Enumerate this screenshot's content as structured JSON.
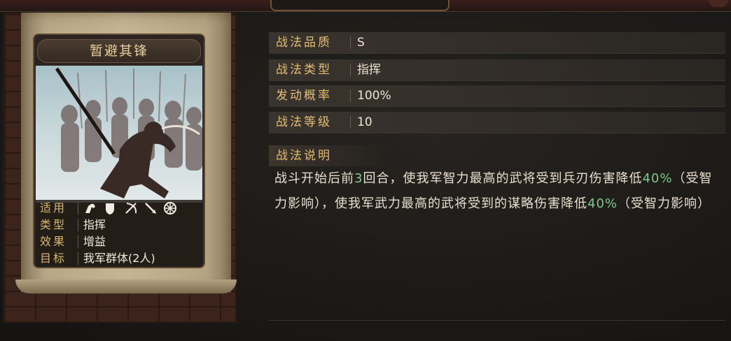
{
  "skill_card": {
    "title": "暂避其锋",
    "info_rows": [
      {
        "key": "适用",
        "value": ""
      },
      {
        "key": "类型",
        "value": "指挥"
      },
      {
        "key": "效果",
        "value": "增益"
      },
      {
        "key": "目标",
        "value": "我军群体(2人)"
      }
    ],
    "applicable_icons": [
      "cavalry-icon",
      "shield-icon",
      "bow-icon",
      "spear-icon",
      "wheel-icon"
    ]
  },
  "stats": [
    {
      "key": "战法品质",
      "value": "S"
    },
    {
      "key": "战法类型",
      "value": "指挥"
    },
    {
      "key": "发动概率",
      "value": "100%"
    },
    {
      "key": "战法等级",
      "value": "10"
    }
  ],
  "description": {
    "title": "战法说明",
    "p1": "战斗开始后前",
    "n1": "3",
    "p2": "回合，使我军智力最高的武将受到兵刃伤害降低",
    "n2": "40%",
    "p3": "（受智力影响），使我军武力最高的武将受到的谋略伤害降低",
    "n3": "40%",
    "p4": "（受智力影响）"
  },
  "colors": {
    "accent_gold": "#e3bd74",
    "highlight_green": "#7fc98a"
  }
}
